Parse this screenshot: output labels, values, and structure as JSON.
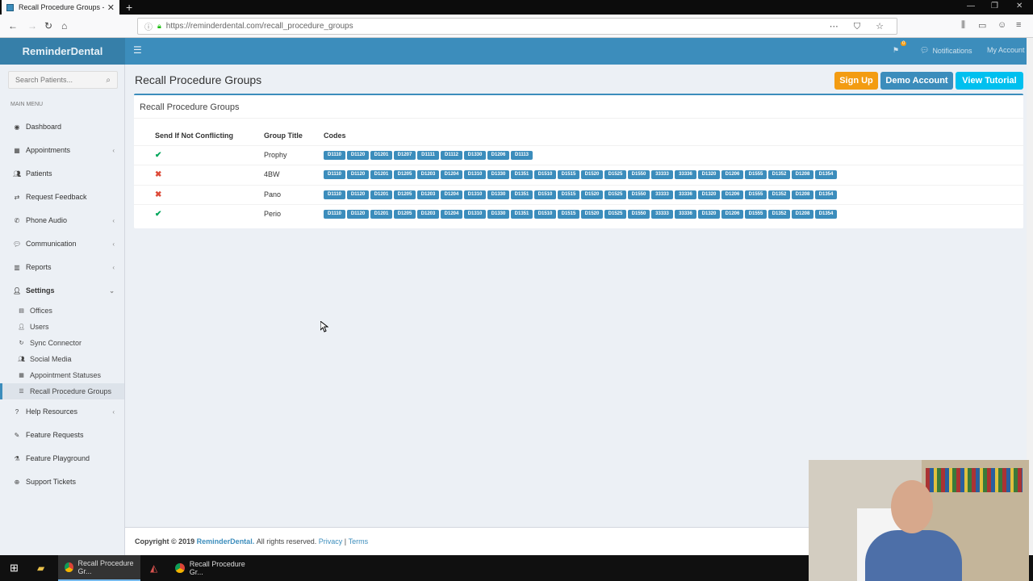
{
  "browser": {
    "tab_title": "Recall Procedure Groups - Rem",
    "new_tab": "+",
    "url": "https://reminderdental.com/recall_procedure_groups"
  },
  "header": {
    "logo": "ReminderDental",
    "notifications_label": "Notifications",
    "account_label": "My Account",
    "flag_count": "0"
  },
  "sidebar": {
    "search_placeholder": "Search Patients...",
    "menu_header": "MAIN MENU",
    "items": [
      {
        "label": "Dashboard",
        "icon": "dashboard-icon"
      },
      {
        "label": "Appointments",
        "icon": "calendar-icon"
      },
      {
        "label": "Patients",
        "icon": "users-icon"
      },
      {
        "label": "Request Feedback",
        "icon": "feedback-icon"
      },
      {
        "label": "Phone Audio",
        "icon": "phone-icon"
      },
      {
        "label": "Communication",
        "icon": "comments-icon"
      },
      {
        "label": "Reports",
        "icon": "chart-icon"
      },
      {
        "label": "Settings",
        "icon": "user-icon"
      }
    ],
    "sub_items": [
      {
        "label": "Offices"
      },
      {
        "label": "Users"
      },
      {
        "label": "Sync Connector"
      },
      {
        "label": "Social Media"
      },
      {
        "label": "Appointment Statuses"
      },
      {
        "label": "Recall Procedure Groups"
      }
    ],
    "bottom_items": [
      {
        "label": "Help Resources"
      },
      {
        "label": "Feature Requests"
      },
      {
        "label": "Feature Playground"
      },
      {
        "label": "Support Tickets"
      }
    ]
  },
  "main": {
    "page_title": "Recall Procedure Groups",
    "buttons": {
      "sign_up": "Sign Up",
      "demo_account": "Demo Account",
      "view_tutorial": "View Tutorial"
    },
    "box_title": "Recall Procedure Groups",
    "table": {
      "headers": [
        "Send If Not Conflicting",
        "Group Title",
        "Codes"
      ],
      "rows": [
        {
          "send": true,
          "title": "Prophy",
          "codes": [
            "D1110",
            "D1120",
            "D1201",
            "D1207",
            "D1111",
            "D1112",
            "D1330",
            "D1206",
            "D1113"
          ]
        },
        {
          "send": false,
          "title": "4BW",
          "codes": [
            "D1110",
            "D1120",
            "D1201",
            "D1205",
            "D1203",
            "D1204",
            "D1310",
            "D1330",
            "D1351",
            "D1510",
            "D1515",
            "D1520",
            "D1525",
            "D1550",
            "33333",
            "33336",
            "D1320",
            "D1206",
            "D1555",
            "D1352",
            "D1208",
            "D1354"
          ]
        },
        {
          "send": false,
          "title": "Pano",
          "codes": [
            "D1110",
            "D1120",
            "D1201",
            "D1205",
            "D1203",
            "D1204",
            "D1310",
            "D1330",
            "D1351",
            "D1510",
            "D1515",
            "D1520",
            "D1525",
            "D1550",
            "33333",
            "33336",
            "D1320",
            "D1206",
            "D1555",
            "D1352",
            "D1208",
            "D1354"
          ]
        },
        {
          "send": true,
          "title": "Perio",
          "codes": [
            "D1110",
            "D1120",
            "D1201",
            "D1205",
            "D1203",
            "D1204",
            "D1310",
            "D1330",
            "D1351",
            "D1510",
            "D1515",
            "D1520",
            "D1525",
            "D1550",
            "33333",
            "33336",
            "D1320",
            "D1206",
            "D1555",
            "D1352",
            "D1208",
            "D1354"
          ]
        }
      ]
    }
  },
  "footer": {
    "copyright": "Copyright © 2019",
    "brand": "ReminderDental.",
    "rights": "All rights reserved.",
    "privacy": "Privacy",
    "separator": "|",
    "terms": "Terms"
  },
  "taskbar": {
    "task1": "Recall Procedure Gr...",
    "task2": "Recall Procedure Gr..."
  },
  "colors": {
    "primary": "#3c8dbc",
    "warning": "#f39c12",
    "info": "#00c0ef",
    "success": "#00a65a",
    "danger": "#dd4b39"
  }
}
